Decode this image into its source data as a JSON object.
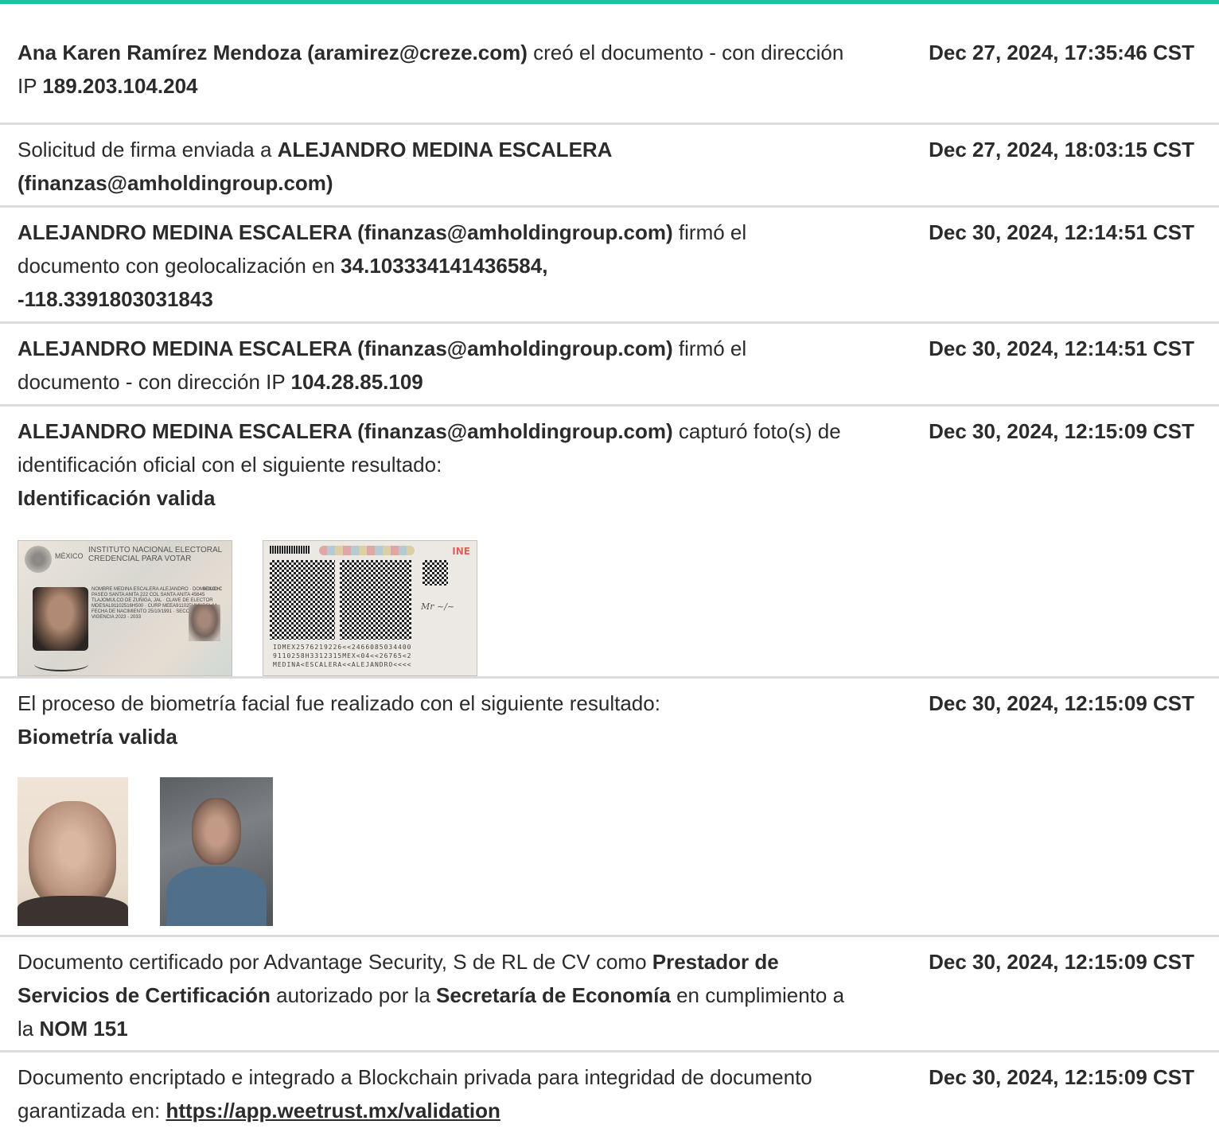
{
  "colors": {
    "accent_bar": "#19c3a0",
    "divider": "#dcdcdc",
    "text": "#2b2b2b"
  },
  "entries": [
    {
      "actor": "Ana Karen Ramírez Mendoza (aramirez@creze.com)",
      "action": " creó el documento - con dirección IP ",
      "ip": "189.203.104.204",
      "date": "Dec 27, 2024, 17:35:46 CST"
    },
    {
      "prefix": "Solicitud de firma enviada a ",
      "actor_name": "ALEJANDRO MEDINA ESCALERA",
      "actor_email": "(finanzas@amholdingroup.com)",
      "date": "Dec 27, 2024, 18:03:15 CST"
    },
    {
      "actor_name": "ALEJANDRO MEDINA ESCALERA",
      "actor_email": " (finanzas@amholdingroup.com)",
      "action": " firmó el documento con geolocalización en ",
      "geo_lat": "34.103334141436584,",
      "geo_lon": "-118.3391803031843",
      "date": "Dec 30, 2024, 12:14:51 CST"
    },
    {
      "actor_name": "ALEJANDRO MEDINA ESCALERA",
      "actor_email": " (finanzas@amholdingroup.com)",
      "action": " firmó el documento - con dirección IP ",
      "ip": "104.28.85.109",
      "date": "Dec 30, 2024, 12:14:51 CST"
    },
    {
      "actor_name": "ALEJANDRO MEDINA ESCALERA",
      "actor_email": " (finanzas@amholdingroup.com)",
      "action": " capturó foto(s) de identificación oficial con el siguiente resultado:",
      "result": "Identificación valida",
      "date": "Dec 30, 2024, 12:15:09 CST",
      "id_front": {
        "country": "MÉXICO",
        "institute_line1": "INSTITUTO NACIONAL ELECTORAL",
        "institute_line2": "CREDENCIAL PARA VOTAR",
        "fields_text": "NOMBRE MEDINA ESCALERA ALEJANDRO · DOMICILIO C PASEO SANTA ANITA 222 COL SANTA ANITA 45645 TLAJOMULCO DE ZUÑIGA, JAL · CLAVE DE ELECTOR MDESAL91102516H500 · CURP MEEA911025HMNDSL04 · FECHA DE NACIMIENTO 25/10/1991 · SECCIÓN 2466 · VIGENCIA 2023 - 2033",
        "sex": "SEXO H"
      },
      "id_back": {
        "logo": "INE",
        "mrz_line1": "IDMEX2576219226<<2466085034400",
        "mrz_line2": "9110258H3312315MEX<04<<26765<2",
        "mrz_line3": "MEDINA<ESCALERA<<ALEJANDRO<<<<"
      }
    },
    {
      "text": "El proceso de biometría facial fue realizado con el siguiente resultado:",
      "result": "Biometría valida",
      "date": "Dec 30, 2024, 12:15:09 CST"
    },
    {
      "prefix": "Documento certificado por Advantage Security, S de RL de CV como ",
      "bold1": "Prestador de Servicios de Certificación",
      "middle": " autorizado por la ",
      "bold2": "Secretaría de Economía",
      "middle2": " en cumplimiento a la ",
      "bold3": "NOM 151",
      "date": "Dec 30, 2024, 12:15:09 CST"
    },
    {
      "prefix": "Documento encriptado e integrado a Blockchain privada para integridad de documento garantizada en: ",
      "link": "https://app.weetrust.mx/validation",
      "date": "Dec 30, 2024, 12:15:09 CST"
    }
  ]
}
